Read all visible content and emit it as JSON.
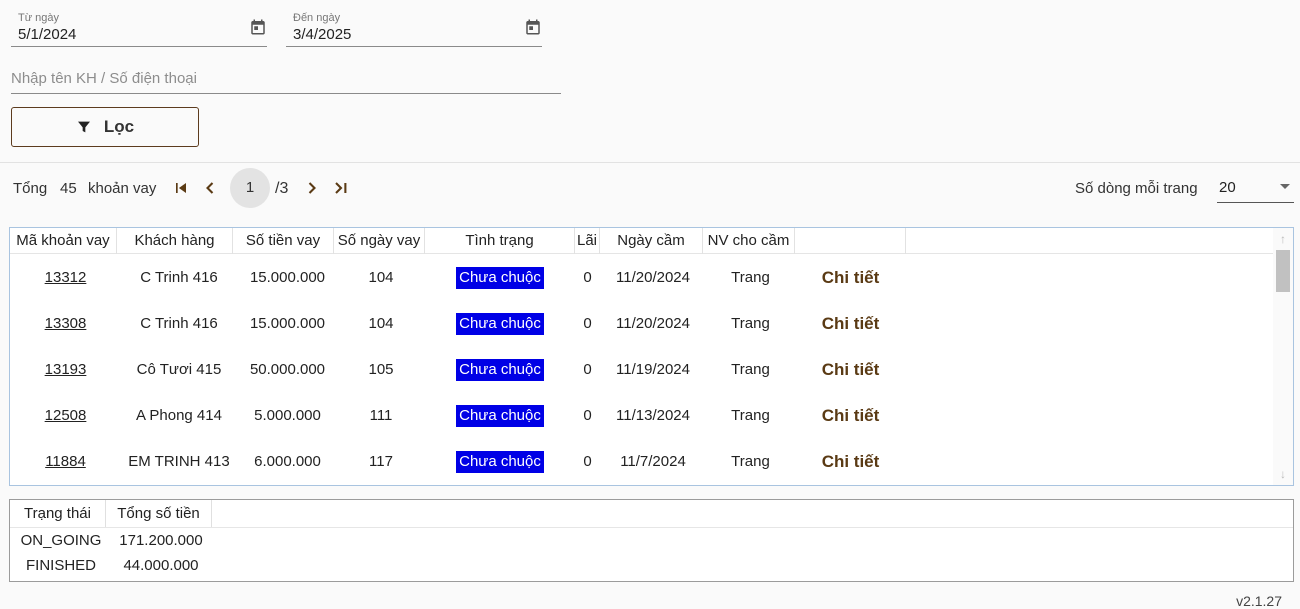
{
  "filters": {
    "from_date": {
      "label": "Từ ngày",
      "value": "5/1/2024"
    },
    "to_date": {
      "label": "Đến ngày",
      "value": "3/4/2025"
    },
    "search_placeholder": "Nhập tên KH / Số điện thoại",
    "filter_button": "Lọc"
  },
  "pager": {
    "total_label": "Tổng",
    "total": "45",
    "unit": "khoản vay",
    "current_page": "1",
    "total_pages": "/3",
    "rows_per_page_label": "Số dòng mỗi trang",
    "rows_per_page": "20"
  },
  "grid": {
    "columns": [
      "Mã khoản vay",
      "Khách hàng",
      "Số tiền vay",
      "Số ngày vay",
      "Tình trạng",
      "Lãi",
      "Ngày cầm",
      "NV cho cầm"
    ],
    "detail_label": "Chi tiết",
    "rows": [
      {
        "code": "13312",
        "customer": "C Trinh 416",
        "amount": "15.000.000",
        "days": "104",
        "status": "Chưa chuộc",
        "interest": "0",
        "date": "11/20/2024",
        "staff": "Trang"
      },
      {
        "code": "13308",
        "customer": "C Trinh 416",
        "amount": "15.000.000",
        "days": "104",
        "status": "Chưa chuộc",
        "interest": "0",
        "date": "11/20/2024",
        "staff": "Trang"
      },
      {
        "code": "13193",
        "customer": "Cô Tươi 415",
        "amount": "50.000.000",
        "days": "105",
        "status": "Chưa chuộc",
        "interest": "0",
        "date": "11/19/2024",
        "staff": "Trang"
      },
      {
        "code": "12508",
        "customer": "A Phong 414",
        "amount": "5.000.000",
        "days": "111",
        "status": "Chưa chuộc",
        "interest": "0",
        "date": "11/13/2024",
        "staff": "Trang"
      },
      {
        "code": "11884",
        "customer": "EM TRINH 413",
        "amount": "6.000.000",
        "days": "117",
        "status": "Chưa chuộc",
        "interest": "0",
        "date": "11/7/2024",
        "staff": "Trang"
      }
    ]
  },
  "summary": {
    "columns": [
      "Trạng thái",
      "Tổng số tiền"
    ],
    "rows": [
      {
        "state": "ON_GOING",
        "total": "171.200.000"
      },
      {
        "state": "FINISHED",
        "total": "44.000.000"
      }
    ]
  },
  "version": "v2.1.27",
  "colors": {
    "status_badge": "#0000e6",
    "detail_link": "#5a3a14",
    "pager_icons": "#5a3a14"
  }
}
